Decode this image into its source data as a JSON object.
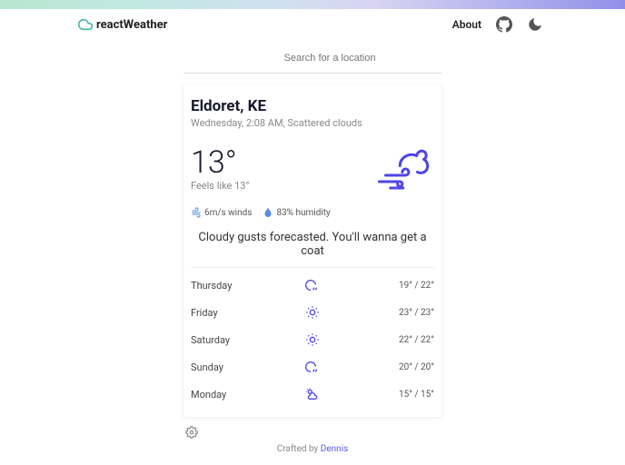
{
  "brand": {
    "name": "reactWeather"
  },
  "header": {
    "about": "About"
  },
  "search": {
    "placeholder": "Search for a location"
  },
  "current": {
    "location": "Eldoret, KE",
    "datetime": "Wednesday, 2:08 AM, Scattered clouds",
    "temp": "13°",
    "feels": "Feels like 13°",
    "wind": "6m/s winds",
    "humidity": "83% humidity",
    "recommendation": "Cloudy gusts forecasted. You'll wanna get a coat"
  },
  "forecast": [
    {
      "day": "Thursday",
      "temps": "19° / 22°",
      "icon": "cloud-rain"
    },
    {
      "day": "Friday",
      "temps": "23° / 23°",
      "icon": "sun"
    },
    {
      "day": "Saturday",
      "temps": "22° / 22°",
      "icon": "sun"
    },
    {
      "day": "Sunday",
      "temps": "20° / 20°",
      "icon": "cloud-rain"
    },
    {
      "day": "Monday",
      "temps": "15° / 15°",
      "icon": "sun-cloud"
    }
  ],
  "footer": {
    "prefix": "Crafted by ",
    "author": "Dennis"
  }
}
